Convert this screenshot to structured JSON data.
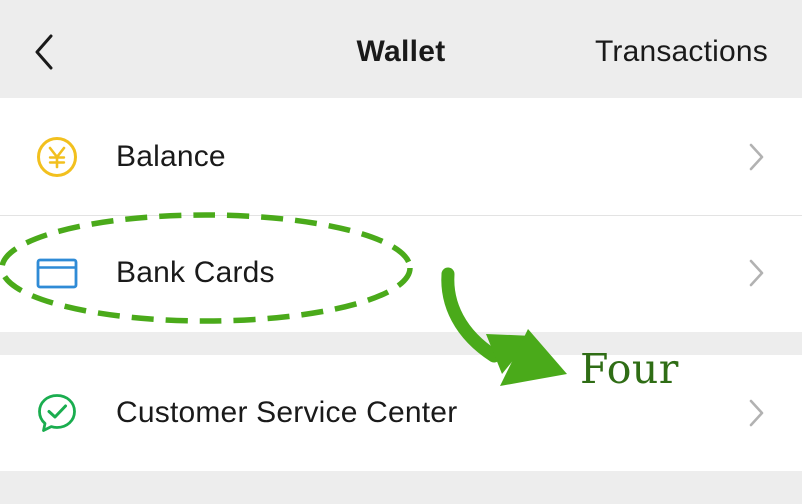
{
  "header": {
    "back_icon": "chevron-left-icon",
    "title": "Wallet",
    "action_label": "Transactions"
  },
  "menu": {
    "group1": [
      {
        "label": "Balance",
        "icon": "yen-coin-icon",
        "icon_color": "#f2c01e"
      },
      {
        "label": "Bank Cards",
        "icon": "bank-card-icon",
        "icon_color": "#2f8bd6"
      }
    ],
    "group2": [
      {
        "label": "Customer Service Center",
        "icon": "chat-check-icon",
        "icon_color": "#1aad4f"
      }
    ],
    "chevron_icon": "chevron-right-icon"
  },
  "annotation": {
    "text": "Four",
    "color": "#4aaa1a",
    "text_color": "#2f6d15"
  },
  "colors": {
    "background": "#ededed",
    "card": "#ffffff",
    "separator": "#e3e3e3",
    "chevron": "#b2b2b2"
  }
}
